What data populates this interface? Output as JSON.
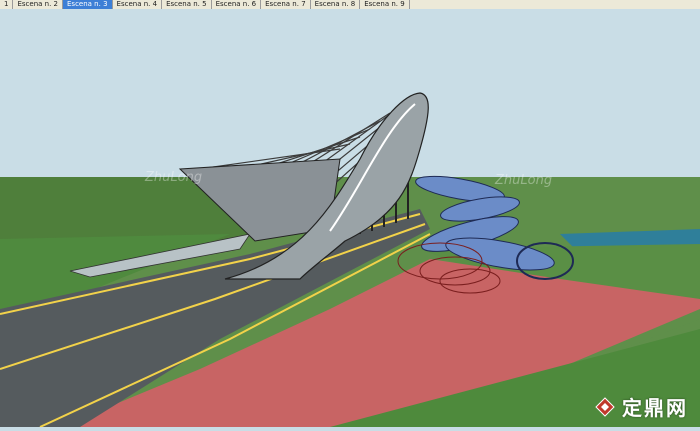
{
  "toolbar": {
    "scene_tabs": [
      {
        "label": "1"
      },
      {
        "label": "Escena n. 2"
      },
      {
        "label": "Escena n. 3",
        "active": true
      },
      {
        "label": "Escena n. 4"
      },
      {
        "label": "Escena n. 5"
      },
      {
        "label": "Escena n. 6"
      },
      {
        "label": "Escena n. 7"
      },
      {
        "label": "Escena n. 8"
      },
      {
        "label": "Escena n. 9"
      }
    ]
  },
  "watermarks": {
    "left": "ZhuLong",
    "right": "ZhuLong",
    "brand": "定鼎网"
  },
  "colors": {
    "sky": "#c9dde6",
    "grass": "#5f8f4a",
    "road": "#555b5e",
    "bike_lane": "#c86464",
    "road_line": "#f2d24a",
    "water": "#2f7f9a",
    "canopy": "#6b8cc8"
  }
}
